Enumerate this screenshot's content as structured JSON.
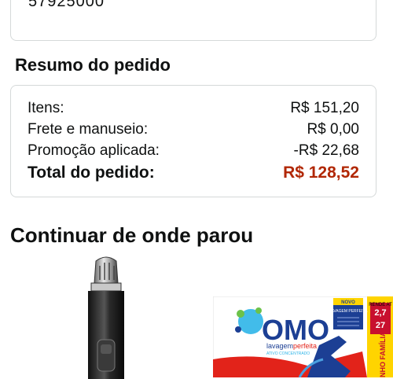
{
  "top_card": {
    "partial_text": "57925000"
  },
  "summary": {
    "heading": "Resumo do pedido",
    "rows": [
      {
        "label": "Itens:",
        "value": "R$ 151,20"
      },
      {
        "label": "Frete e manuseio:",
        "value": "R$ 0,00"
      },
      {
        "label": "Promoção aplicada:",
        "value": "-R$ 22,68"
      }
    ],
    "total": {
      "label": "Total do pedido:",
      "value": "R$ 128,52"
    }
  },
  "continue_section": {
    "heading": "Continuar de onde parou",
    "products": [
      {
        "name_icon": "nose-trimmer-image"
      },
      {
        "name_icon": "omo-detergent-image",
        "brand": "OMO",
        "tagline_part1": "lavagem",
        "tagline_part2": "perfeita",
        "sub": "ATIVO CONCENTRADO",
        "badge": "NOVO",
        "badge_text": "LAVAGEM PERFEITA",
        "side_num1": "2,7",
        "side_num2": "27",
        "side_text": "NHO FAMÍLIA",
        "side_top": "RENDE AT"
      }
    ]
  },
  "colors": {
    "total_price": "#b12704",
    "border": "#d5d9d9",
    "omo_blue": "#1c3f94",
    "omo_yellow": "#ffd400"
  }
}
